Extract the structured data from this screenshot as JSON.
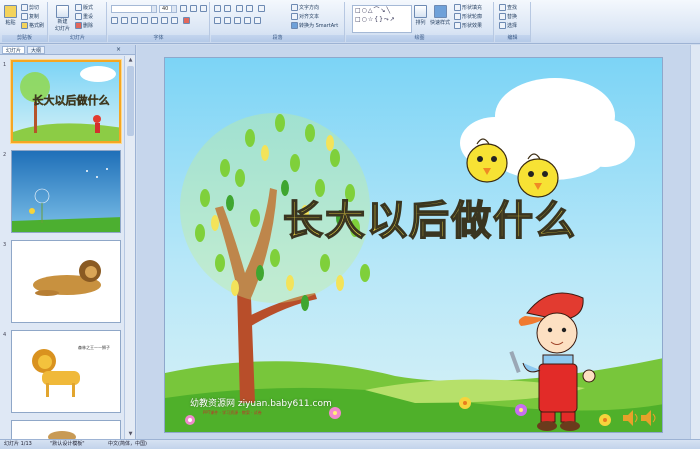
{
  "ribbon": {
    "clipboard": {
      "label": "剪贴板",
      "paste": "粘贴",
      "cut": "剪切",
      "copy": "复制",
      "format_painter": "格式刷"
    },
    "slides": {
      "label": "幻灯片",
      "new_slide": "新建",
      "new_slide_2": "幻灯片",
      "layout": "版式",
      "reset": "重设",
      "delete": "删除"
    },
    "font": {
      "label": "字体",
      "font_size": "40"
    },
    "paragraph": {
      "label": "段落",
      "text_direction": "文字方向",
      "align_text": "对齐文本",
      "smartart": "转换为 SmartArt"
    },
    "drawing": {
      "label": "绘图",
      "arrange": "排列",
      "quick_styles": "快速样式",
      "shape_fill": "形状填充",
      "shape_outline": "形状轮廓",
      "shape_effects": "形状效果"
    },
    "editing": {
      "label": "编辑",
      "find": "查找",
      "replace": "替换",
      "select": "选择"
    }
  },
  "left_panel": {
    "tabs": [
      "幻灯片",
      "大纲"
    ],
    "close": "×",
    "slide_numbers": [
      "1",
      "2",
      "3",
      "4"
    ]
  },
  "slide": {
    "title": "长大以后做什么",
    "watermark": "幼教资源网 ziyuan.baby611.com",
    "watermark_sub": "PPT课件 · 学习资源 · 教案 · 试卷"
  },
  "thumb_text": {
    "slide1_title": "长大以后做什么",
    "slide4_caption": "森林之王——狮子"
  },
  "statusbar": {
    "slide_count": "幻灯片 1/13",
    "theme": "\"默认设计模板\"",
    "language": "中文(简体，中国)"
  },
  "colors": {
    "accent": "#f5a623",
    "title_fill": "#f7e24a",
    "sky": "#7cd4f6"
  }
}
